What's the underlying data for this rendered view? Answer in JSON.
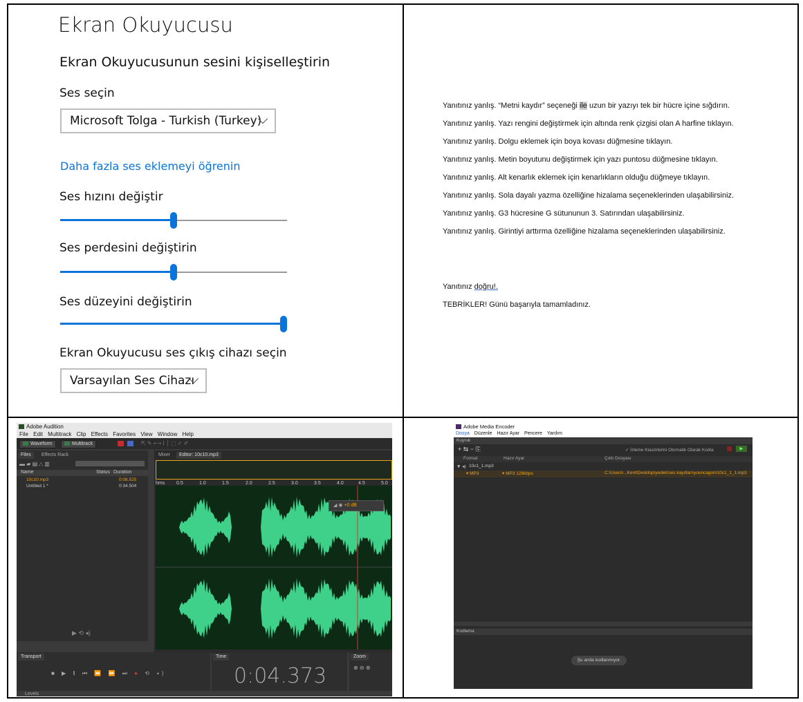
{
  "narrator": {
    "title": "Ekran Okuyucusu",
    "subtitle": "Ekran Okuyucusunun sesini kişiselleştirin",
    "voice_label": "Ses seçin",
    "voice_value": "Microsoft Tolga - Turkish (Turkey)",
    "more_voices_link": "Daha fazla ses eklemeyi öğrenin",
    "speed_label": "Ses hızını değiştir",
    "speed_value": 0.5,
    "pitch_label": "Ses perdesini değiştirin",
    "pitch_value": 0.5,
    "volume_label": "Ses düzeyini değiştirin",
    "volume_value": 1.0,
    "output_label": "Ekran Okuyucusu ses çıkış cihazı seçin",
    "output_value": "Varsayılan Ses Cihazı"
  },
  "feedback": {
    "lines": [
      "Yanıtınız yanlış. “Metni kaydır” seçeneği ",
      "Yanıtınız yanlış.  Yazı rengini değiştirmek için altında renk çizgisi olan A harfine tıklayın.",
      "Yanıtınız yanlış.  Dolgu eklemek için boya kovası düğmesine tıklayın.",
      "Yanıtınız yanlış.  Metin boyutunu değiştirmek için yazı puntosu düğmesine tıklayın.",
      "Yanıtınız yanlış.  Alt kenarlık eklemek için kenarlıkların olduğu düğmeye tıklayın.",
      "Yanıtınız yanlış.  Sola dayalı yazma özelliğine hizalama seçeneklerinden ulaşabilirsiniz.",
      "Yanıtınız yanlış. G3 hücresine G sütununun 3. Satırından ulaşabilirsiniz.",
      "Yanıtınız yanlış. Girintiyi arttırma özelliğine hizalama seçeneklerinden ulaşabilirsiniz."
    ],
    "line0_highlight": "ile",
    "line0_rest": " uzun bir yazıyı tek bir hücre içine sığdırın.",
    "correct_prefix": "Yanıtınız ",
    "correct_word": "doğru!.",
    "congrats": "TEBRİKLER! Günü başarıyla tamamladınız."
  },
  "audition": {
    "app_title": "Adobe Audition",
    "menu": [
      "File",
      "Edit",
      "Multitrack",
      "Clip",
      "Effects",
      "Favorites",
      "View",
      "Window",
      "Help"
    ],
    "waveform_btn": "Waveform",
    "multitrack_btn": "Multitrack",
    "files_tab": "Files",
    "effects_rack_tab": "Effects Rack",
    "mixer_tab": "Mixer",
    "editor_tab": "Editor: 10c10.mp3",
    "col_name": "Name",
    "col_status": "Status",
    "col_duration": "Duration",
    "files": [
      {
        "name": "10c10.mp3",
        "duration": "0:08.525"
      },
      {
        "name": "Untitled 1 *",
        "duration": "0:34.504"
      }
    ],
    "ruler_unit": "hms",
    "ruler_ticks": [
      "0.5",
      "1.0",
      "1.5",
      "2.0",
      "2.5",
      "3.0",
      "3.5",
      "4.0",
      "4.5",
      "5.0"
    ],
    "hud_value": "+0 dB",
    "transport_tab": "Transport",
    "time_tab": "Time",
    "zoom_tab": "Zoom",
    "levels_tab": "Levels",
    "timecode": "0:04.373",
    "colors": {
      "wave": "#3fd08a",
      "bg": "#0c2a14",
      "accent": "#e8a317"
    }
  },
  "encoder": {
    "app_title": "Adobe Media Encoder",
    "menu": [
      "Dosya",
      "Düzenle",
      "Hazır Ayar",
      "Pencere",
      "Yardım"
    ],
    "queue_tab": "Kuyruk",
    "auto_encode": "İzleme Klasörlerini Otomatik Olarak Kodla",
    "col_format": "Format",
    "col_preset": "Hazır Ayar",
    "col_output": "Çıktı Dosyası",
    "source": "10c1_1.mp3",
    "format": "MP3",
    "preset": "MP3 128kbps",
    "output_path": "C:\\Users\\...Kent\\Desktop\\yedek\\ses kayıtları\\youncagon\\10c1_1_1.mp3",
    "encoding_tab": "Kodlama",
    "status": "Şu anda kodlanmıyor."
  }
}
